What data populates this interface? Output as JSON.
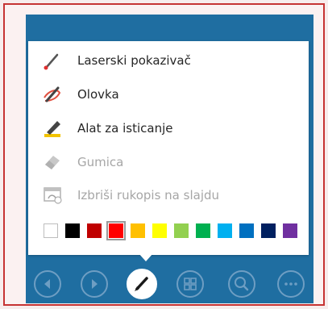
{
  "menu": {
    "items": [
      {
        "label": "Laserski pokazivač",
        "icon": "laser-pointer-icon",
        "enabled": true
      },
      {
        "label": "Olovka",
        "icon": "pen-icon",
        "enabled": true
      },
      {
        "label": "Alat za isticanje",
        "icon": "highlighter-icon",
        "enabled": true
      },
      {
        "label": "Gumica",
        "icon": "eraser-icon",
        "enabled": false
      },
      {
        "label": "Izbriši rukopis na slajdu",
        "icon": "erase-ink-icon",
        "enabled": false
      }
    ],
    "palette": [
      "#ffffff",
      "#000000",
      "#c00000",
      "#ff0000",
      "#ffc000",
      "#ffff00",
      "#92d050",
      "#00b050",
      "#00b0f0",
      "#0070c0",
      "#002060",
      "#7030a0"
    ],
    "selected_color": "#ff0000"
  },
  "toolbar": {
    "buttons": [
      {
        "icon": "previous-icon",
        "active": false
      },
      {
        "icon": "next-icon",
        "active": false
      },
      {
        "icon": "pen-icon",
        "active": true
      },
      {
        "icon": "slides-grid-icon",
        "active": false
      },
      {
        "icon": "zoom-icon",
        "active": false
      },
      {
        "icon": "more-options-icon",
        "active": false
      }
    ]
  },
  "colors": {
    "slide_background": "#1f6ea1",
    "frame_border": "#c63333"
  }
}
